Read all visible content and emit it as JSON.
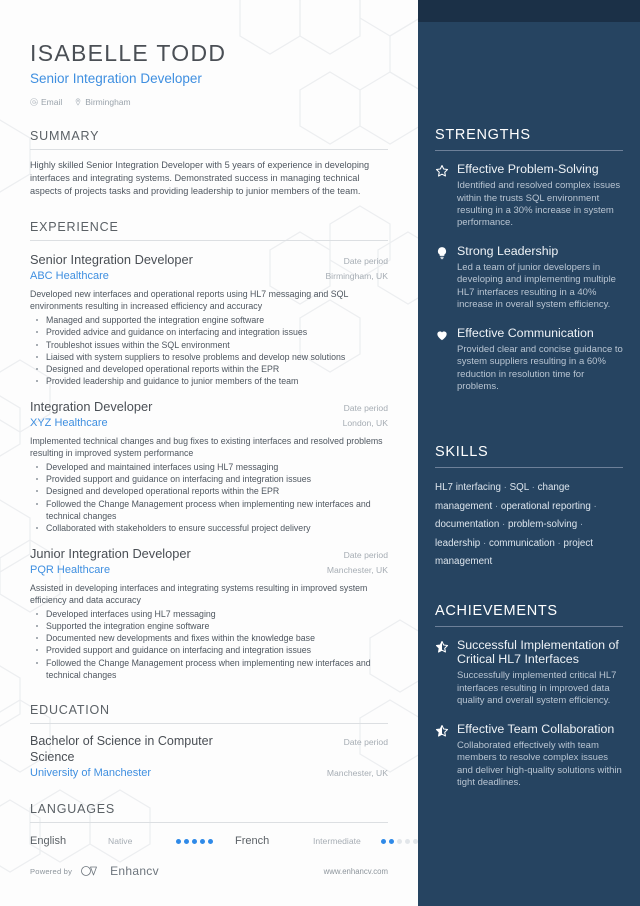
{
  "theme": {
    "sidebar_bg": "#264461",
    "sidebar_top_band": "#1b3047",
    "accent_blue": "#3f8fe0",
    "dot_active": "#2f8ae8",
    "dot_inactive": "#e2e6ea",
    "heading_gray": "#5b6166",
    "body_gray": "#4f5760"
  },
  "header": {
    "name": "ISABELLE TODD",
    "role": "Senior Integration Developer",
    "contacts": [
      {
        "icon": "email-icon",
        "label": "Email"
      },
      {
        "icon": "location-pin-icon",
        "label": "Birmingham"
      }
    ]
  },
  "summary": {
    "heading": "SUMMARY",
    "text": "Highly skilled Senior Integration Developer with 5 years of experience in developing interfaces and integrating systems. Demonstrated success in managing technical aspects of projects tasks and providing leadership to junior members of the team."
  },
  "experience": {
    "heading": "EXPERIENCE",
    "jobs": [
      {
        "title": "Senior Integration Developer",
        "date": "Date period",
        "org": "ABC Healthcare",
        "location": "Birmingham, UK",
        "lead": "Developed new interfaces and operational reports using HL7 messaging and SQL environments resulting in increased efficiency and accuracy",
        "bullets": [
          "Managed and supported the integration engine software",
          "Provided advice and guidance on interfacing and integration issues",
          "Troubleshot issues within the SQL environment",
          "Liaised with system suppliers to resolve problems and develop new solutions",
          "Designed and developed operational reports within the EPR",
          "Provided leadership and guidance to junior members of the team"
        ]
      },
      {
        "title": "Integration Developer",
        "date": "Date period",
        "org": "XYZ Healthcare",
        "location": "London, UK",
        "lead": "Implemented technical changes and bug fixes to existing interfaces and resolved problems resulting in improved system performance",
        "bullets": [
          "Developed and maintained interfaces using HL7 messaging",
          "Provided support and guidance on interfacing and integration issues",
          "Designed and developed operational reports within the EPR",
          "Followed the Change Management process when implementing new interfaces and technical changes",
          "Collaborated with stakeholders to ensure successful project delivery"
        ]
      },
      {
        "title": "Junior Integration Developer",
        "date": "Date period",
        "org": "PQR Healthcare",
        "location": "Manchester, UK",
        "lead": "Assisted in developing interfaces and integrating systems resulting in improved system efficiency and data accuracy",
        "bullets": [
          "Developed interfaces using HL7 messaging",
          "Supported the integration engine software",
          "Documented new developments and fixes within the knowledge base",
          "Provided support and guidance on interfacing and integration issues",
          "Followed the Change Management process when implementing new interfaces and technical changes"
        ]
      }
    ]
  },
  "education": {
    "heading": "EDUCATION",
    "entries": [
      {
        "degree": "Bachelor of Science in Computer Science",
        "date": "Date period",
        "school": "University of Manchester",
        "location": "Manchester, UK"
      }
    ]
  },
  "languages": {
    "heading": "LANGUAGES",
    "items": [
      {
        "name": "English",
        "level": "Native",
        "filled": 5,
        "total": 5
      },
      {
        "name": "French",
        "level": "Intermediate",
        "filled": 2,
        "total": 5
      }
    ]
  },
  "footer": {
    "powered_by": "Powered by",
    "brand": "Enhancv",
    "website": "www.enhancv.com"
  },
  "sidebar": {
    "strengths": {
      "heading": "STRENGTHS",
      "items": [
        {
          "icon": "star-outline-icon",
          "title": "Effective Problem-Solving",
          "desc": "Identified and resolved complex issues within the trusts SQL environment resulting in a 30% increase in system performance."
        },
        {
          "icon": "lightbulb-icon",
          "title": "Strong Leadership",
          "desc": "Led a team of junior developers in developing and implementing multiple HL7 interfaces resulting in a 40% increase in overall system efficiency."
        },
        {
          "icon": "heart-icon",
          "title": "Effective Communication",
          "desc": "Provided clear and concise guidance to system suppliers resulting in a 60% reduction in resolution time for problems."
        }
      ]
    },
    "skills": {
      "heading": "SKILLS",
      "items": [
        "HL7 interfacing",
        "SQL",
        "change management",
        "operational reporting",
        "documentation",
        "problem-solving",
        "leadership",
        "communication",
        "project management"
      ],
      "separator": "·"
    },
    "achievements": {
      "heading": "ACHIEVEMENTS",
      "items": [
        {
          "icon": "star-half-icon",
          "title": "Successful Implementation of Critical HL7 Interfaces",
          "desc": "Successfully implemented critical HL7 interfaces resulting in improved data quality and overall system efficiency."
        },
        {
          "icon": "star-half-icon",
          "title": "Effective Team Collaboration",
          "desc": "Collaborated effectively with team members to resolve complex issues and deliver high-quality solutions within tight deadlines."
        }
      ]
    }
  }
}
